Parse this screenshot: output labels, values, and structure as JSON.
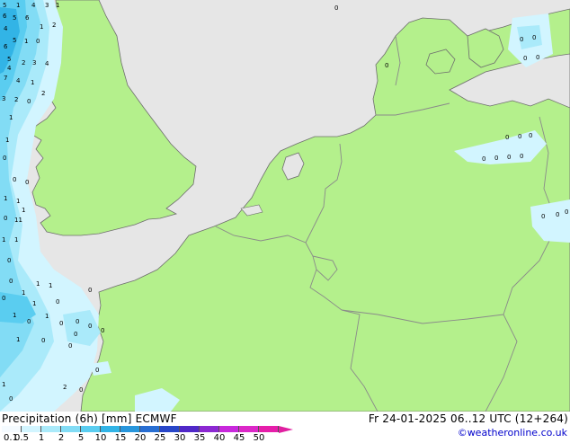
{
  "footer": {
    "title": "Precipitation (6h) [mm] ECMWF",
    "valid": "Fr 24-01-2025 06..12 UTC (12+264)",
    "credit": "©weatheronline.co.uk"
  },
  "colors": {
    "sea": "#e6e6e6",
    "land": "#b4f08c",
    "border": "#8a8a8a",
    "coast": "#6e6e6e"
  },
  "legend": {
    "labels": [
      "0.1",
      "0.5",
      "1",
      "2",
      "5",
      "10",
      "15",
      "20",
      "25",
      "30",
      "35",
      "40",
      "45",
      "50"
    ],
    "colors": [
      "#f5fbff",
      "#d2f5ff",
      "#aaeafa",
      "#82dcf5",
      "#5acdf0",
      "#32b4e6",
      "#2896dc",
      "#286ed2",
      "#2846c8",
      "#5028c8",
      "#8c28d2",
      "#c828dc",
      "#dc28c8",
      "#e61eaa"
    ]
  },
  "precip_values": [
    {
      "v": "5"
    },
    {
      "v": "1"
    },
    {
      "v": "4"
    },
    {
      "v": "3"
    },
    {
      "v": "1"
    },
    {
      "v": "6"
    },
    {
      "v": "5"
    },
    {
      "v": "6"
    },
    {
      "v": "2"
    },
    {
      "v": "1"
    },
    {
      "v": "4"
    },
    {
      "v": "1"
    },
    {
      "v": "0"
    },
    {
      "v": "5"
    },
    {
      "v": "2"
    },
    {
      "v": "5"
    },
    {
      "v": "3"
    },
    {
      "v": "4"
    },
    {
      "v": "4"
    },
    {
      "v": "6"
    },
    {
      "v": "7"
    },
    {
      "v": "4"
    },
    {
      "v": "1"
    },
    {
      "v": "2"
    },
    {
      "v": "3"
    },
    {
      "v": "2"
    },
    {
      "v": "0"
    },
    {
      "v": "1"
    },
    {
      "v": "1"
    },
    {
      "v": "0"
    },
    {
      "v": "0"
    },
    {
      "v": "0"
    },
    {
      "v": "1"
    },
    {
      "v": "1"
    },
    {
      "v": "0"
    },
    {
      "v": "1"
    },
    {
      "v": "11"
    },
    {
      "v": "1"
    },
    {
      "v": "1"
    },
    {
      "v": "0"
    },
    {
      "v": "0"
    },
    {
      "v": "1"
    },
    {
      "v": "1"
    },
    {
      "v": "0"
    },
    {
      "v": "1"
    },
    {
      "v": "1"
    },
    {
      "v": "0"
    },
    {
      "v": "1"
    },
    {
      "v": "0"
    },
    {
      "v": "0"
    },
    {
      "v": "0"
    },
    {
      "v": "1"
    },
    {
      "v": "0"
    },
    {
      "v": "0"
    },
    {
      "v": "0"
    },
    {
      "v": "0"
    },
    {
      "v": "0"
    },
    {
      "v": "1"
    },
    {
      "v": "0"
    },
    {
      "v": "0"
    },
    {
      "v": "1"
    },
    {
      "v": "2"
    },
    {
      "v": "0"
    },
    {
      "v": "0"
    },
    {
      "v": "0"
    },
    {
      "v": "0"
    },
    {
      "v": "0"
    },
    {
      "v": "0"
    },
    {
      "v": "0"
    },
    {
      "v": "0"
    },
    {
      "v": "0"
    },
    {
      "v": "0"
    },
    {
      "v": "0"
    },
    {
      "v": "0"
    },
    {
      "v": "0"
    },
    {
      "v": "0"
    },
    {
      "v": "0"
    },
    {
      "v": "0"
    },
    {
      "v": "0"
    },
    {
      "v": "0"
    }
  ]
}
